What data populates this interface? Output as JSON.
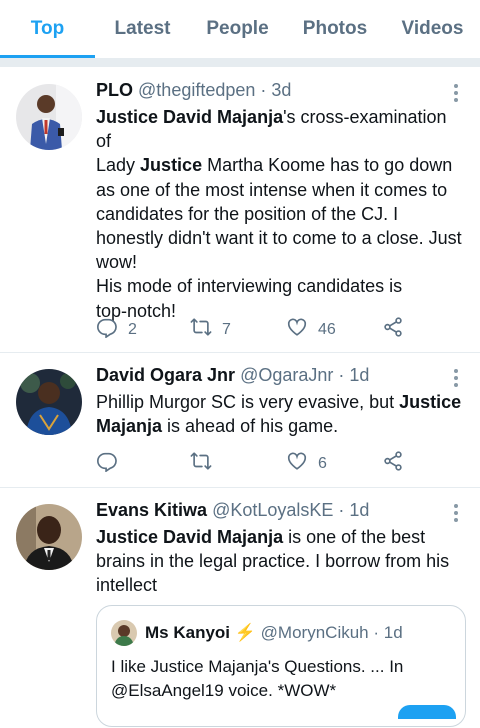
{
  "tabs": [
    "Top",
    "Latest",
    "People",
    "Photos",
    "Videos"
  ],
  "tweets": [
    {
      "name": "PLO",
      "handle": "@thegiftedpen",
      "time": "3d",
      "lines": [
        {
          "segments": [
            {
              "t": "Justice David Majanja",
              "b": true
            },
            {
              "t": "'s cross-examination of"
            }
          ]
        },
        {
          "segments": [
            {
              "t": "Lady "
            },
            {
              "t": "Justice",
              "b": true
            },
            {
              "t": " Martha Koome has to go down"
            }
          ]
        },
        {
          "segments": [
            {
              "t": "as one of the most intense when it comes to"
            }
          ]
        },
        {
          "segments": [
            {
              "t": "candidates for the position of the CJ. I"
            }
          ]
        },
        {
          "segments": [
            {
              "t": "honestly didn't want it to come to a close. Just"
            }
          ]
        },
        {
          "segments": [
            {
              "t": "wow!"
            }
          ]
        },
        {
          "segments": [
            {
              "t": "His mode of interviewing candidates is"
            }
          ]
        },
        {
          "segments": [
            {
              "t": "top-notch!"
            }
          ]
        }
      ],
      "replies": "2",
      "retweets": "7",
      "likes": "46"
    },
    {
      "name": "David Ogara Jnr",
      "handle": "@OgaraJnr",
      "time": "1d",
      "lines": [
        {
          "segments": [
            {
              "t": "Phillip Murgor SC is very evasive, but "
            },
            {
              "t": "Justice",
              "b": true
            }
          ]
        },
        {
          "segments": [
            {
              "t": "Majanja",
              "b": true
            },
            {
              "t": " is ahead of his game."
            }
          ]
        }
      ],
      "replies": "",
      "retweets": "",
      "likes": "6"
    },
    {
      "name": "Evans Kitiwa",
      "handle": "@KotLoyalsKE",
      "time": "1d",
      "lines": [
        {
          "segments": [
            {
              "t": "Justice David Majanja",
              "b": true
            },
            {
              "t": " is one of the best"
            }
          ]
        },
        {
          "segments": [
            {
              "t": "brains in the legal practice. I borrow from his"
            }
          ]
        },
        {
          "segments": [
            {
              "t": "intellect"
            }
          ]
        }
      ]
    }
  ],
  "quote": {
    "name": "Ms Kanyoi",
    "badge": "⚡",
    "handle": "@MorynCikuh",
    "time": "1d",
    "lines": [
      "I like Justice Majanja's Questions. ... In",
      "@ElsaAngel19 voice. *WOW*"
    ]
  },
  "icons": {
    "reply": "reply-icon",
    "retweet": "retweet-icon",
    "like": "heart-icon",
    "share": "share-icon",
    "more": "more-options-icon"
  },
  "colors": {
    "accent": "#1da1f2",
    "secondary_text": "#5b7083",
    "divider": "#e6ecf0"
  }
}
